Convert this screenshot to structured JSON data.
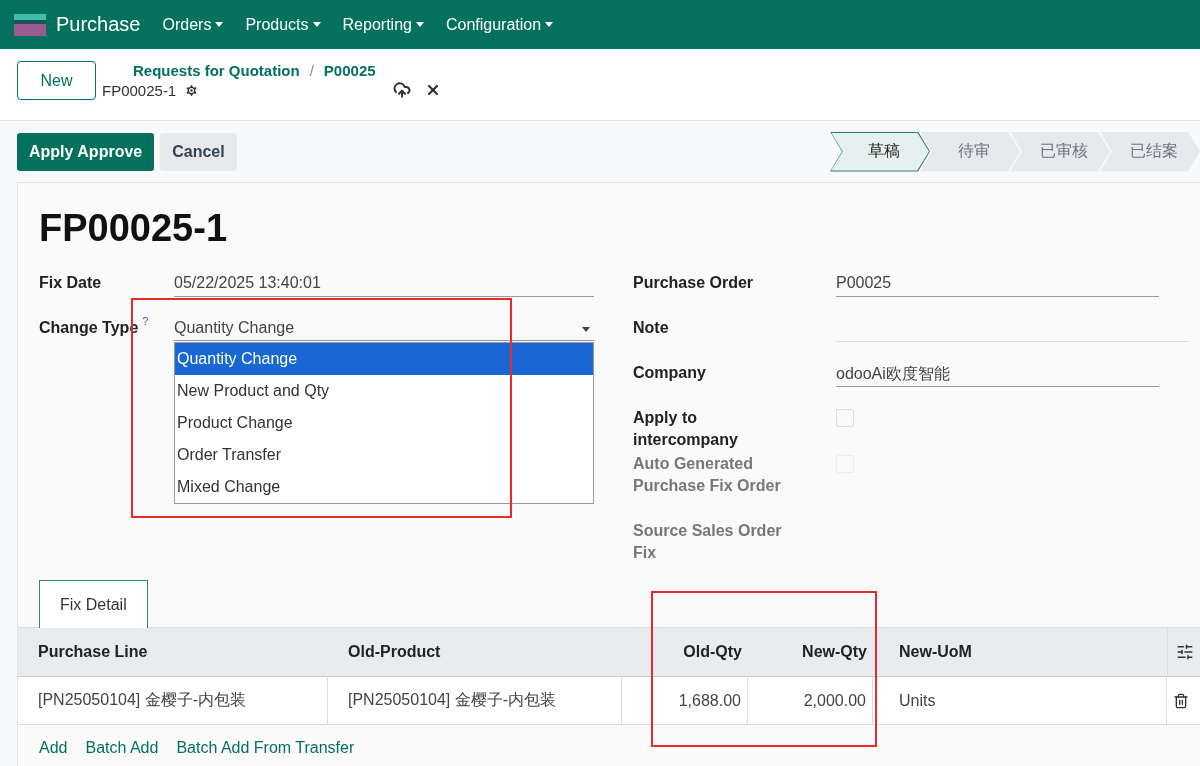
{
  "navbar": {
    "app_name": "Purchase",
    "menus": [
      "Orders",
      "Products",
      "Reporting",
      "Configuration"
    ]
  },
  "control_panel": {
    "new_button": "New",
    "breadcrumbs": [
      "Requests for Quotation",
      "P00025"
    ],
    "breadcrumb_separator": "/",
    "record_name": "FP00025-1"
  },
  "action_buttons": [
    {
      "label": "Apply Approve",
      "kind": "primary"
    },
    {
      "label": "Cancel",
      "kind": "secondary"
    }
  ],
  "status_steps": [
    {
      "label": "草稿",
      "selected": true
    },
    {
      "label": "待审",
      "selected": false
    },
    {
      "label": "已审核",
      "selected": false
    },
    {
      "label": "已结案",
      "selected": false
    }
  ],
  "title": "FP00025-1",
  "left_fields": {
    "fix_date": {
      "label": "Fix Date",
      "value": "05/22/2025 13:40:01"
    },
    "change_type": {
      "label": "Change Type",
      "help": "?",
      "value": "Quantity Change",
      "options": [
        {
          "label": "Quantity Change",
          "selected": true
        },
        {
          "label": "New Product and Qty",
          "selected": false
        },
        {
          "label": "Product Change",
          "selected": false
        },
        {
          "label": "Order Transfer",
          "selected": false
        },
        {
          "label": "Mixed Change",
          "selected": false
        }
      ]
    }
  },
  "right_fields": [
    {
      "kind": "text",
      "label": "Purchase Order",
      "value": "P00025",
      "readonly": false
    },
    {
      "kind": "text",
      "label": "Note",
      "readonly": false
    },
    {
      "kind": "text",
      "label": "Company",
      "value": "odooAi欧度智能",
      "readonly": false
    },
    {
      "kind": "checkbox",
      "label": "Apply to intercompany",
      "checked": false,
      "readonly": false
    },
    {
      "kind": "checkbox",
      "label": "Auto Generated Purchase Fix Order",
      "checked": false,
      "readonly": true
    },
    {
      "kind": "none",
      "label": "Source Sales Order Fix",
      "readonly": true
    }
  ],
  "tabs": [
    {
      "label": "Fix Detail",
      "selected": true
    }
  ],
  "table": {
    "columns": [
      {
        "label": "Purchase Line",
        "kind": "text"
      },
      {
        "label": "Old-Product",
        "kind": "text"
      },
      {
        "label": "Old-Qty",
        "kind": "number"
      },
      {
        "label": "New-Qty",
        "kind": "number"
      },
      {
        "label": "New-UoM",
        "kind": "unit"
      }
    ],
    "rows": [
      {
        "cells": [
          "[PN25050104] 金樱子-内包装",
          "[PN25050104] 金樱子-内包装",
          "1,688.00",
          "2,000.00",
          "Units"
        ]
      }
    ]
  },
  "add_links": [
    "Add",
    "Batch Add",
    "Batch Add From Transfer"
  ]
}
